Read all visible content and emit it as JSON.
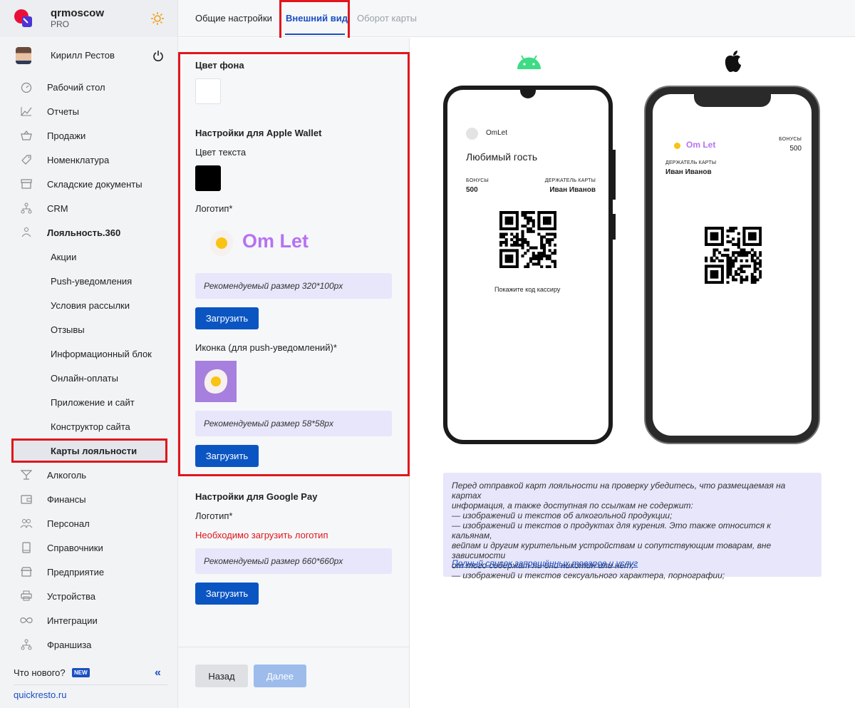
{
  "brand": {
    "name": "qrmoscow",
    "plan": "PRO"
  },
  "user": {
    "name": "Кирилл Рестов"
  },
  "nav": [
    {
      "label": "Рабочий стол",
      "icon": "dashboard-icon"
    },
    {
      "label": "Отчеты",
      "icon": "chart-icon"
    },
    {
      "label": "Продажи",
      "icon": "basket-icon"
    },
    {
      "label": "Номенклатура",
      "icon": "tag-icon"
    },
    {
      "label": "Складские документы",
      "icon": "archive-icon"
    },
    {
      "label": "CRM",
      "icon": "hierarchy-icon"
    },
    {
      "label": "Лояльность.360",
      "icon": "loyalty-icon"
    },
    {
      "label": "Акции"
    },
    {
      "label": "Push-уведомления"
    },
    {
      "label": "Условия рассылки"
    },
    {
      "label": "Отзывы"
    },
    {
      "label": "Информационный блок"
    },
    {
      "label": "Онлайн-оплаты"
    },
    {
      "label": "Приложение и сайт"
    },
    {
      "label": "Конструктор сайта"
    },
    {
      "label": "Карты лояльности"
    },
    {
      "label": "Алкоголь",
      "icon": "cocktail-icon"
    },
    {
      "label": "Финансы",
      "icon": "wallet-icon"
    },
    {
      "label": "Персонал",
      "icon": "people-icon"
    },
    {
      "label": "Справочники",
      "icon": "book-icon"
    },
    {
      "label": "Предприятие",
      "icon": "store-icon"
    },
    {
      "label": "Устройства",
      "icon": "printer-icon"
    },
    {
      "label": "Интеграции",
      "icon": "infinity-icon"
    },
    {
      "label": "Франшиза",
      "icon": "hierarchy-icon"
    }
  ],
  "footer": {
    "whats_new": "Что нового?",
    "new_badge": "NEW",
    "collapse": "«",
    "site": "quickresto.ru"
  },
  "tabs": [
    {
      "label": "Общие настройки"
    },
    {
      "label": "Внешний вид"
    },
    {
      "label": "Оборот карты"
    }
  ],
  "settings": {
    "bg_color_label": "Цвет фона",
    "bg_color": "#ffffff",
    "apple_heading": "Настройки для Apple Wallet",
    "text_color_label": "Цвет текста",
    "text_color": "#000000",
    "logo_label": "Логотип*",
    "logo_text": "Om Let",
    "logo_hint": "Рекомендуемый размер 320*100px",
    "upload_label": "Загрузить",
    "icon_label": "Иконка (для push-уведомлений)*",
    "icon_hint": "Рекомендуемый размер 58*58px",
    "google_heading": "Настройки для Google Pay",
    "google_logo_label": "Логотип*",
    "google_logo_error": "Необходимо загрузить логотип",
    "google_hint": "Рекомендуемый размер 660*660px",
    "back_label": "Назад",
    "next_label": "Далее"
  },
  "android_card": {
    "name": "OmLet",
    "title": "Любимый гость",
    "bonus_label": "БОНУСЫ",
    "bonus_value": "500",
    "holder_label": "ДЕРЖАТЕЛЬ КАРТЫ",
    "holder_value": "Иван Иванов",
    "qr_hint": "Покажите код кассиру"
  },
  "apple_card": {
    "logo_text": "Om Let",
    "bonus_label": "БОНУСЫ",
    "bonus_value": "500",
    "holder_label": "ДЕРЖАТЕЛЬ КАРТЫ",
    "holder_value": "Иван Иванов"
  },
  "notice": {
    "text": "Перед отправкой карт лояльности на проверку убедитесь, что размещаемая на картах\nинформация, а также доступная по ссылкам не содержит:\n— изображений и текстов об алкогольной продукции;\n— изображений и текстов о продуктах для курения. Это также относится к кальянам,\nвейпам и другим курительным устройствам и сопутствующим товарам, вне зависимости\nот того содержат ли они никотин или нет;\n— изображений и текстов сексуального характера, порнографии;",
    "link": "Полный список запрещённых товаров и услуг"
  },
  "colors": {
    "accent": "#0b55c3",
    "highlight": "#e0161c",
    "hint_bg": "#e7e6fb",
    "brand_purple": "#b672f2"
  }
}
